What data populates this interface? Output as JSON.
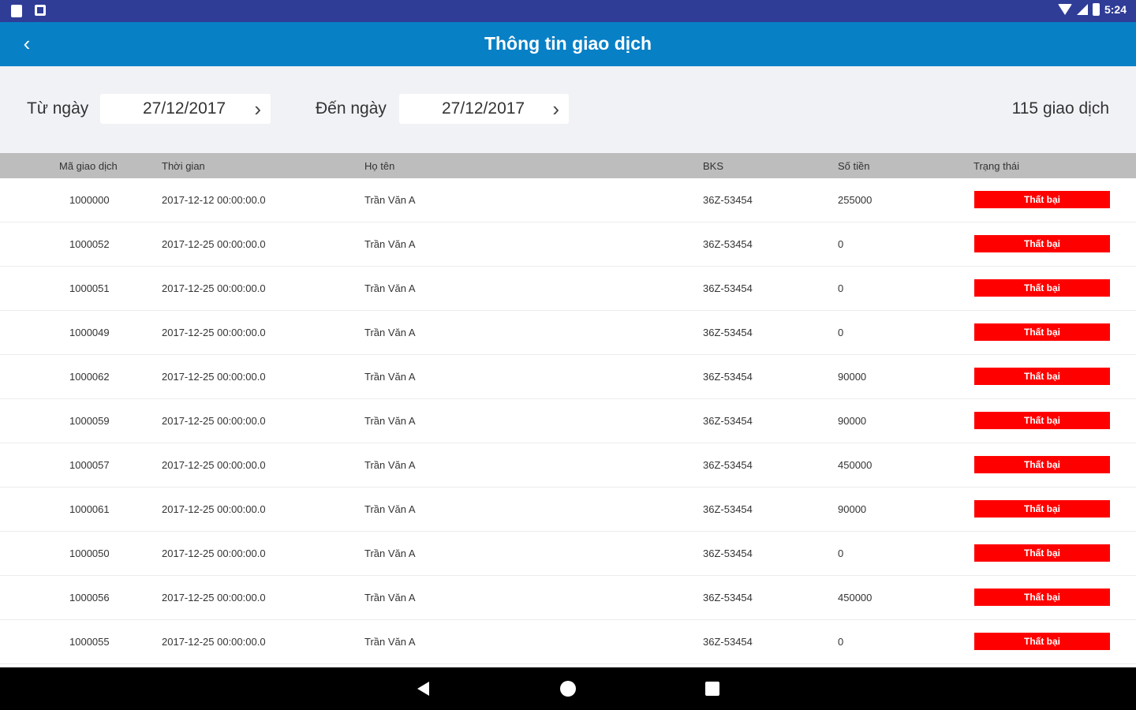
{
  "statusbar": {
    "time": "5:24"
  },
  "appbar": {
    "title": "Thông tin giao dịch",
    "back_icon": "‹"
  },
  "filter": {
    "from_label": "Từ ngày",
    "from_value": "27/12/2017",
    "to_label": "Đến ngày",
    "to_value": "27/12/2017",
    "chevron": "›",
    "count_text": "115 giao dịch"
  },
  "table": {
    "headers": [
      "Mã giao dịch",
      "Thời gian",
      "Họ tên",
      "BKS",
      "Số tiền",
      "Trạng thái"
    ],
    "rows": [
      {
        "id": "1000000",
        "time": "2017-12-12 00:00:00.0",
        "name": "Trần Văn A",
        "plate": "36Z-53454",
        "amount": "255000",
        "status": "Thất bại"
      },
      {
        "id": "1000052",
        "time": "2017-12-25 00:00:00.0",
        "name": "Trần Văn A",
        "plate": "36Z-53454",
        "amount": "0",
        "status": "Thất bại"
      },
      {
        "id": "1000051",
        "time": "2017-12-25 00:00:00.0",
        "name": "Trần Văn A",
        "plate": "36Z-53454",
        "amount": "0",
        "status": "Thất bại"
      },
      {
        "id": "1000049",
        "time": "2017-12-25 00:00:00.0",
        "name": "Trần Văn A",
        "plate": "36Z-53454",
        "amount": "0",
        "status": "Thất bại"
      },
      {
        "id": "1000062",
        "time": "2017-12-25 00:00:00.0",
        "name": "Trần Văn A",
        "plate": "36Z-53454",
        "amount": "90000",
        "status": "Thất bại"
      },
      {
        "id": "1000059",
        "time": "2017-12-25 00:00:00.0",
        "name": "Trần Văn A",
        "plate": "36Z-53454",
        "amount": "90000",
        "status": "Thất bại"
      },
      {
        "id": "1000057",
        "time": "2017-12-25 00:00:00.0",
        "name": "Trần Văn A",
        "plate": "36Z-53454",
        "amount": "450000",
        "status": "Thất bại"
      },
      {
        "id": "1000061",
        "time": "2017-12-25 00:00:00.0",
        "name": "Trần Văn A",
        "plate": "36Z-53454",
        "amount": "90000",
        "status": "Thất bại"
      },
      {
        "id": "1000050",
        "time": "2017-12-25 00:00:00.0",
        "name": "Trần Văn A",
        "plate": "36Z-53454",
        "amount": "0",
        "status": "Thất bại"
      },
      {
        "id": "1000056",
        "time": "2017-12-25 00:00:00.0",
        "name": "Trần Văn A",
        "plate": "36Z-53454",
        "amount": "450000",
        "status": "Thất bại"
      },
      {
        "id": "1000055",
        "time": "2017-12-25 00:00:00.0",
        "name": "Trần Văn A",
        "plate": "36Z-53454",
        "amount": "0",
        "status": "Thất bại"
      }
    ]
  },
  "colors": {
    "statusbar": "#2f3d97",
    "appbar": "#0880c6",
    "status_failed": "#ff0000",
    "header_bg": "#bdbdbd"
  },
  "icons": {
    "back": "back-arrow-icon",
    "chevron": "chevron-right-icon",
    "nav": [
      "nav-back-icon",
      "nav-home-icon",
      "nav-recents-icon"
    ]
  }
}
